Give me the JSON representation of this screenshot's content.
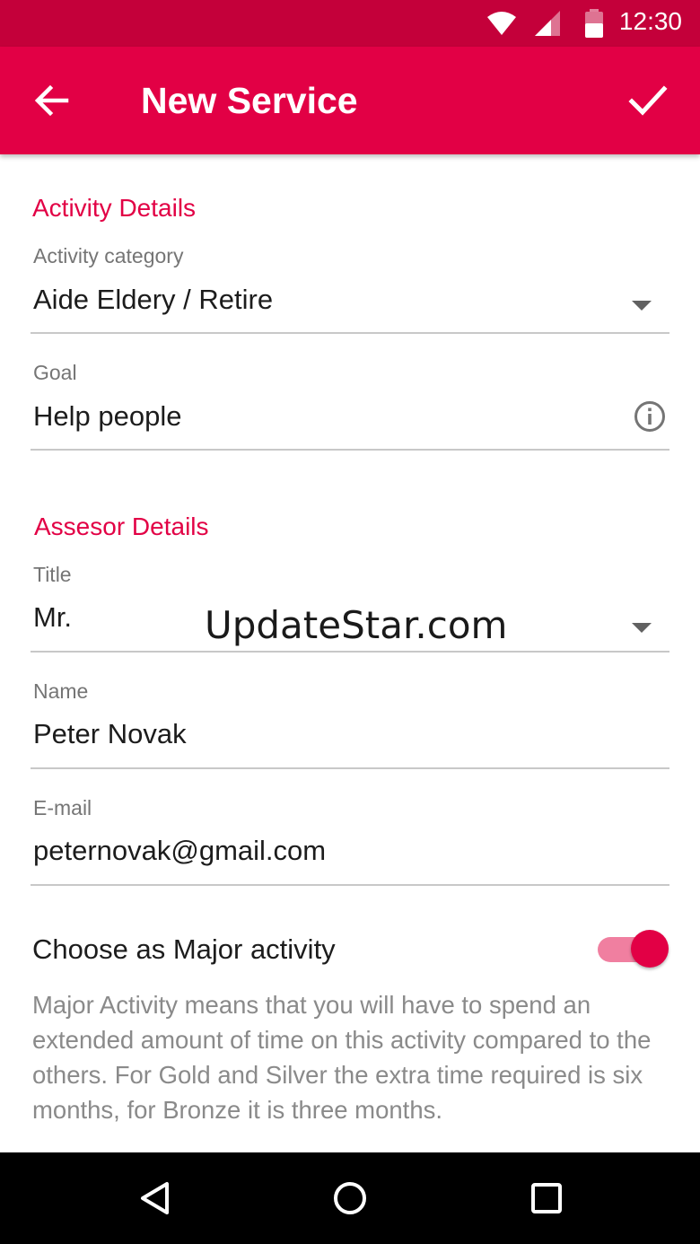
{
  "status_bar": {
    "time": "12:30",
    "icons": [
      "wifi-icon",
      "signal-icon",
      "battery-icon"
    ]
  },
  "app_bar": {
    "title": "New Service",
    "back_icon": "arrow-back-icon",
    "done_icon": "check-icon"
  },
  "activity_details": {
    "heading": "Activity Details",
    "category": {
      "label": "Activity category",
      "value": "Aide Eldery / Retire"
    },
    "goal": {
      "label": "Goal",
      "value": "Help people",
      "icon": "info-icon"
    }
  },
  "assessor_details": {
    "heading": "Assesor Details",
    "title_field": {
      "label": "Title",
      "value": "Mr."
    },
    "name_field": {
      "label": "Name",
      "value": "Peter Novak"
    },
    "email_field": {
      "label": "E-mail",
      "value": "peternovak@gmail.com"
    }
  },
  "watermark": "UpdateStar.com",
  "major_activity": {
    "label": "Choose as Major activity",
    "enabled": true,
    "description": "Major Activity means that you will have to spend an extended amount of time on this activity compared to the others. For Gold and Silver the extra time required is six months, for Bronze it is three months."
  },
  "nav_bar": {
    "icons": [
      "back-triangle-icon",
      "home-circle-icon",
      "recents-square-icon"
    ]
  },
  "colors": {
    "status_bar": "#c4003a",
    "app_bar": "#e20045",
    "accent": "#e20045",
    "switch_track": "#f07fa0"
  }
}
